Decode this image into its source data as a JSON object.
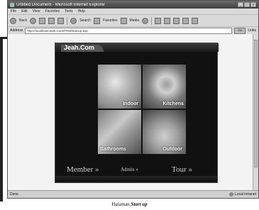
{
  "window": {
    "title": "Untitled Document - Microsoft Internet Explorer",
    "controls": [
      "_",
      "□",
      "x"
    ]
  },
  "menu": [
    "File",
    "Edit",
    "View",
    "Favorites",
    "Tools",
    "Help"
  ],
  "toolbar": {
    "back": "Back",
    "search": "Search",
    "favorites": "Favorites",
    "media": "Media"
  },
  "address": {
    "label": "Address",
    "value": "http://localhost/Jeah.Com/FRMStartUp.asp",
    "go": "Go",
    "links": "Links"
  },
  "site": {
    "logo": "Jeah.Com",
    "tiles": [
      {
        "label": "Indoor"
      },
      {
        "label": "Kitchens"
      },
      {
        "label": "Bathrooms"
      },
      {
        "label": "Outdoor"
      }
    ],
    "nav": {
      "member": "Member »",
      "admin": "Admin »",
      "tour": "Tour »"
    }
  },
  "status": {
    "left": "Done",
    "right": "Local intranet"
  },
  "caption": {
    "prefix": "Halaman",
    "emph": "Start up"
  }
}
